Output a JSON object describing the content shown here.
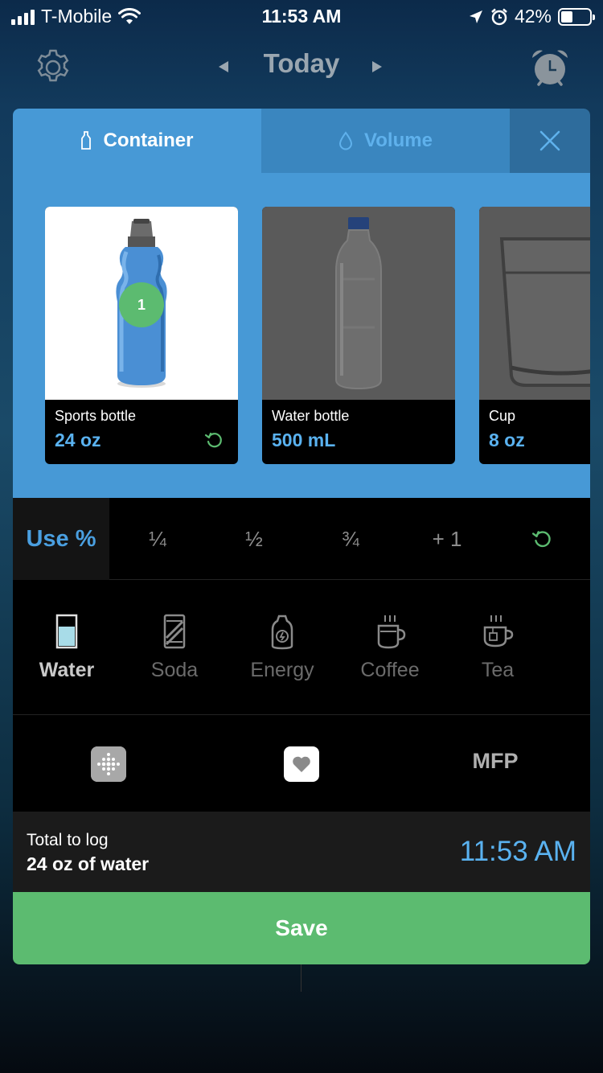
{
  "status_bar": {
    "carrier": "T-Mobile",
    "time": "11:53 AM",
    "battery": "42%"
  },
  "header": {
    "title": "Today"
  },
  "tabs": [
    {
      "label": "Container",
      "icon": "bottle-icon",
      "active": true
    },
    {
      "label": "Volume",
      "icon": "droplet-icon",
      "active": false
    }
  ],
  "containers": [
    {
      "name": "Sports bottle",
      "volume": "24 oz",
      "badge": "1",
      "selected": true
    },
    {
      "name": "Water bottle",
      "volume": "500 mL",
      "selected": false
    },
    {
      "name": "Cup",
      "volume": "8 oz",
      "selected": false
    }
  ],
  "portion_bar": {
    "use_pct_label": "Use %",
    "options": [
      "¼",
      "½",
      "¾",
      "+ 1"
    ]
  },
  "beverages": [
    {
      "label": "Water",
      "icon": "water-glass-icon",
      "active": true
    },
    {
      "label": "Soda",
      "icon": "soda-can-icon",
      "active": false
    },
    {
      "label": "Energy",
      "icon": "energy-drink-icon",
      "active": false
    },
    {
      "label": "Coffee",
      "icon": "coffee-cup-icon",
      "active": false
    },
    {
      "label": "Tea",
      "icon": "tea-cup-icon",
      "active": false
    }
  ],
  "integrations": {
    "fitbit_icon": "fitbit-icon",
    "health_icon": "apple-health-icon",
    "mfp_label": "MFP"
  },
  "total": {
    "label": "Total to log",
    "value": "24 oz of water",
    "time": "11:53 AM"
  },
  "save_label": "Save",
  "colors": {
    "accent_blue": "#4799d6",
    "value_blue": "#5ab2f0",
    "save_green": "#5cbb70"
  }
}
